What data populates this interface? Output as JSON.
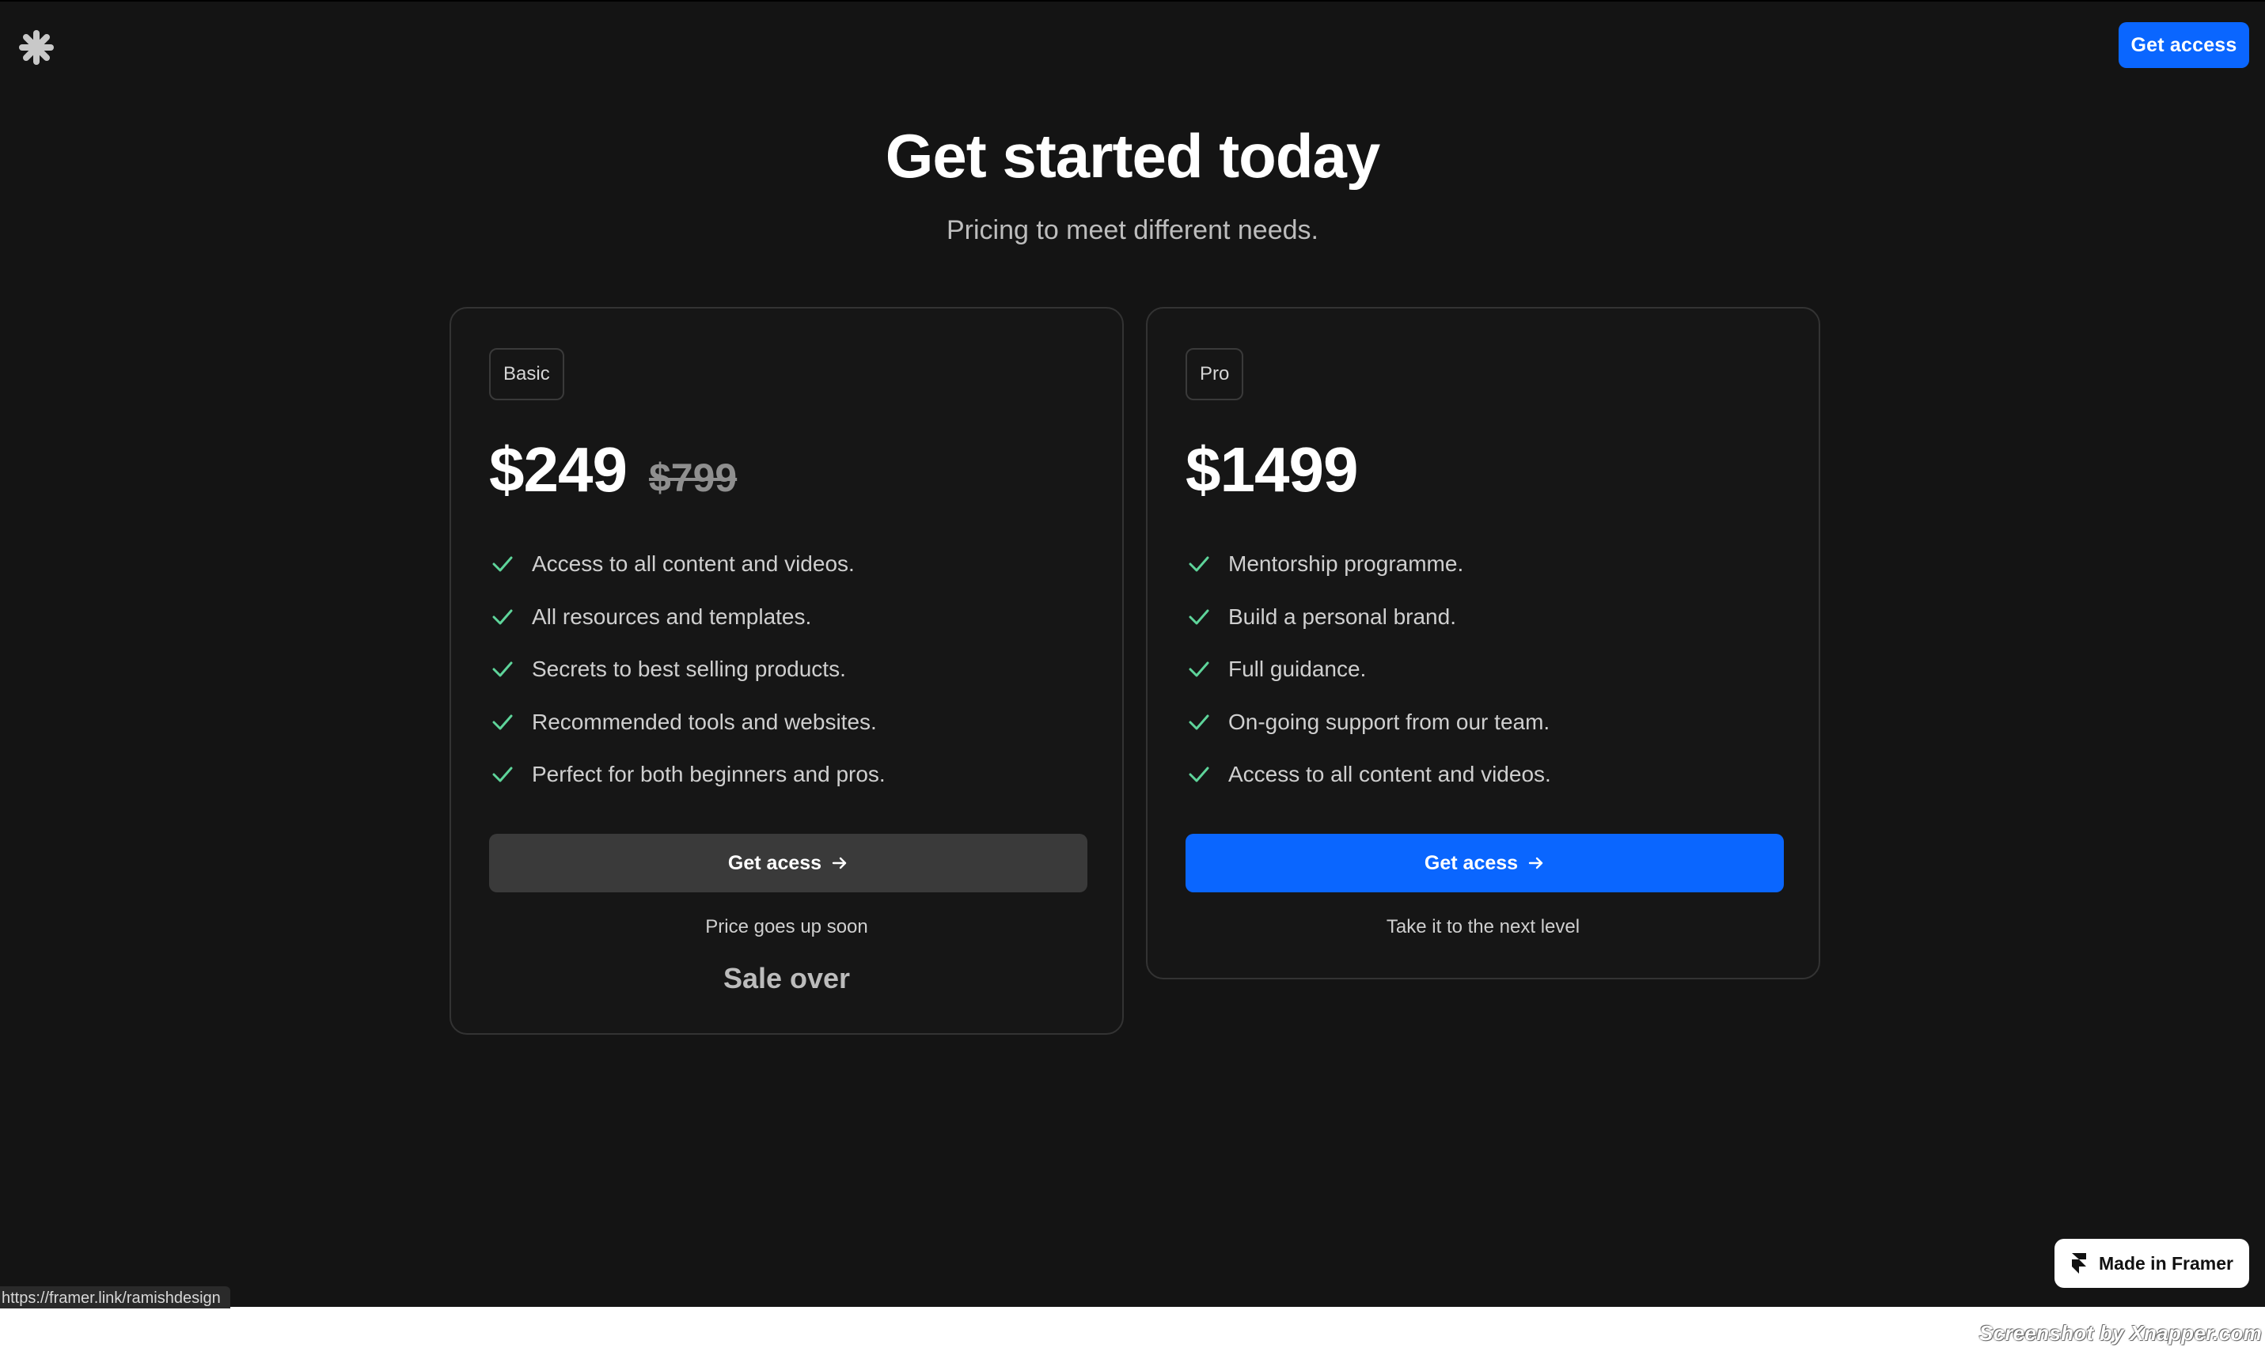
{
  "header": {
    "logo_icon": "asterisk-icon",
    "cta_label": "Get access"
  },
  "hero": {
    "title": "Get started today",
    "subtitle": "Pricing to meet different needs."
  },
  "plans": [
    {
      "badge": "Basic",
      "price": "$249",
      "old_price": "$799",
      "features": [
        "Access to all content and videos.",
        "All resources and templates.",
        "Secrets to best selling products.",
        "Recommended tools and websites.",
        "Perfect for both beginners and pros."
      ],
      "cta_label": "Get acess",
      "note": "Price goes up soon",
      "status": "Sale over"
    },
    {
      "badge": "Pro",
      "price": "$1499",
      "features": [
        "Mentorship programme.",
        "Build a personal brand.",
        "Full guidance.",
        "On-going support from our team.",
        "Access to all content and videos."
      ],
      "cta_label": "Get acess",
      "note": "Take it to the next level"
    }
  ],
  "footer": {
    "framer_badge": "Made in Framer",
    "status_url": "https://framer.link/ramishdesign",
    "watermark": "Screenshot by Xnapper.com"
  },
  "colors": {
    "background": "#141414",
    "accent": "#0a66ff",
    "check": "#5ed49a"
  }
}
